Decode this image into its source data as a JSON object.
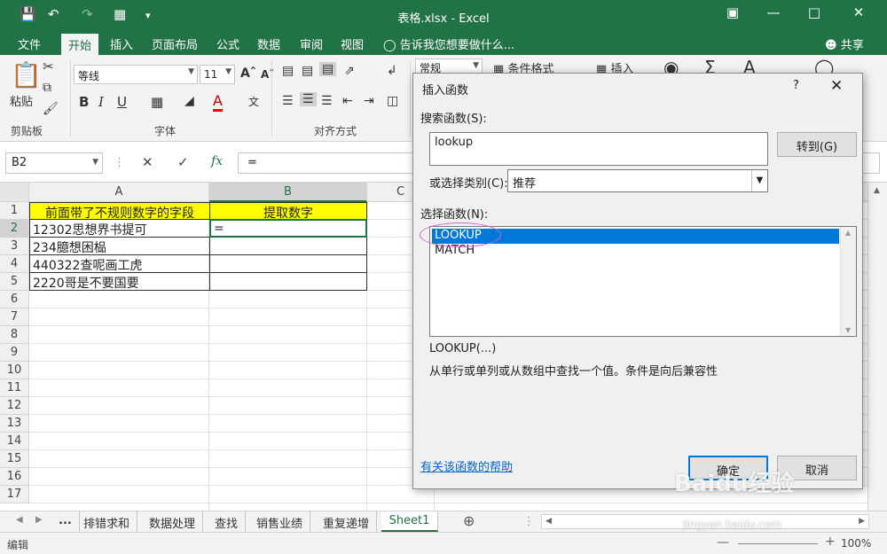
{
  "window": {
    "title": "表格.xlsx - Excel"
  },
  "tabs": [
    "文件",
    "开始",
    "插入",
    "页面布局",
    "公式",
    "数据",
    "审阅",
    "视图"
  ],
  "tell_me": "告诉我您想要做什么...",
  "share": "共享",
  "ribbon": {
    "paste_label": "粘贴",
    "font_name": "等线",
    "font_size": "11",
    "number_format": "常规",
    "conditional_format": "条件格式",
    "insert_label": "插入",
    "groups": {
      "clipboard": "剪贴板",
      "font": "字体",
      "alignment": "对齐方式"
    },
    "accent_color": "#217346"
  },
  "formula_bar": {
    "name_box": "B2",
    "fx": "fx",
    "formula": "="
  },
  "sheet": {
    "columns": [
      "A",
      "B",
      "C"
    ],
    "rows": [
      "1",
      "2",
      "3",
      "4",
      "5",
      "6",
      "7",
      "8",
      "9",
      "10",
      "11",
      "12",
      "13",
      "14",
      "15",
      "16",
      "17"
    ],
    "header_a": "前面带了不规则数字的字段",
    "header_b": "提取数字",
    "data": [
      [
        "12302思想界书提可",
        "="
      ],
      [
        "234臆想困榀",
        ""
      ],
      [
        "440322查呢画工虎",
        ""
      ],
      [
        "2220哥是不要国要",
        ""
      ]
    ]
  },
  "sheet_tabs": [
    "...",
    "排错求和",
    "数据处理",
    "查找",
    "销售业绩",
    "重复递增",
    "Sheet1"
  ],
  "status": {
    "mode": "编辑",
    "zoom": "100%"
  },
  "dialog": {
    "title": "插入函数",
    "help": "?",
    "search_label": "搜索函数(S):",
    "search_value": "lookup",
    "goto_button": "转到(G)",
    "category_label": "或选择类别(C):",
    "category_value": "推荐",
    "select_label": "选择函数(N):",
    "functions": [
      "LOOKUP",
      "MATCH"
    ],
    "signature": "LOOKUP(...)",
    "description": "从单行或单列或从数组中查找一个值。条件是向后兼容性",
    "help_link": "有关该函数的帮助",
    "ok": "确定",
    "cancel": "取消"
  },
  "watermark": {
    "main": "Baidu经验",
    "sub": "jingyan.baidu.com"
  }
}
